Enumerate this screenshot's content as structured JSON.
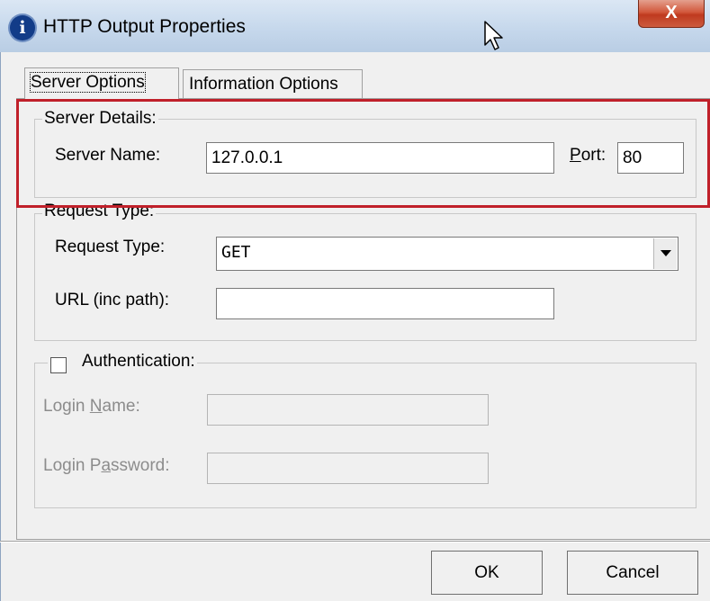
{
  "window": {
    "title": "HTTP Output Properties",
    "close_glyph": "X",
    "app_icon_glyph": "i"
  },
  "tabs": [
    {
      "label": "Server Options",
      "active": true
    },
    {
      "label": "Information Options",
      "active": false
    }
  ],
  "server_details": {
    "legend": "Server Details:",
    "server_name_label": "Server Name:",
    "server_name_value": "127.0.0.1",
    "port_label_accel": "P",
    "port_label_rest": "ort:",
    "port_value": "80"
  },
  "request_type": {
    "legend": "Request Type:",
    "type_label": "Request Type:",
    "type_value": "GET",
    "url_label": "URL (inc path):",
    "url_value": ""
  },
  "authentication": {
    "checkbox_label": "Authentication:",
    "checked": false,
    "login_name_label_pre": "Login ",
    "login_name_label_accel": "N",
    "login_name_label_post": "ame:",
    "login_name_value": "",
    "login_password_label_pre": "Login P",
    "login_password_label_accel": "a",
    "login_password_label_post": "ssword:",
    "login_password_value": ""
  },
  "buttons": {
    "ok": "OK",
    "cancel": "Cancel"
  },
  "colors": {
    "highlight": "#c0202a",
    "title_bar": "#c6d8ec",
    "close_button": "#d2583c"
  },
  "icons": {
    "app": "info-icon",
    "close": "close-icon",
    "cursor": "mouse-cursor-icon",
    "dropdown": "chevron-down-icon"
  }
}
